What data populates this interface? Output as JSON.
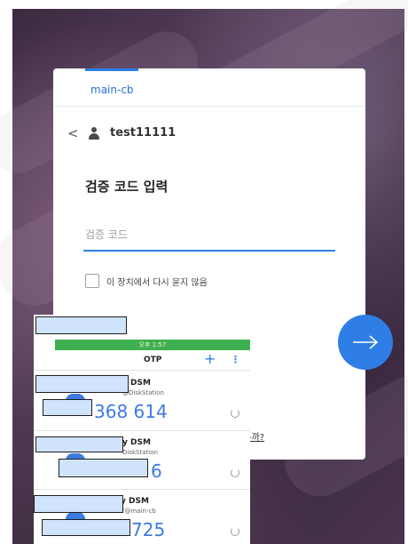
{
  "login": {
    "host": "main-cb",
    "back_glyph": "<",
    "username": "test11111",
    "title": "검증 코드 입력",
    "code_placeholder": "검증 코드",
    "remember_label": "이 장치에서 다시 묻지 않음",
    "link_fragment": "-까?",
    "next_icon": "arrow-right-icon"
  },
  "otp_app": {
    "status_time": "오후 1:57",
    "title": "OTP",
    "add_glyph": "+",
    "more_glyph": "⋮",
    "entries": [
      {
        "name_fragment": "y DSM",
        "account_fragment": "@DiskStation",
        "code": "368 614"
      },
      {
        "name_fragment": "y DSM",
        "account_fragment": "DiskStation",
        "code": "6"
      },
      {
        "name_fragment": "y DSM",
        "account_fragment": "7@main-cb",
        "code": "725"
      }
    ]
  },
  "colors": {
    "accent": "#2f7ee6",
    "status_green": "#3fb04f",
    "redaction_fill": "#cfe3fb"
  }
}
